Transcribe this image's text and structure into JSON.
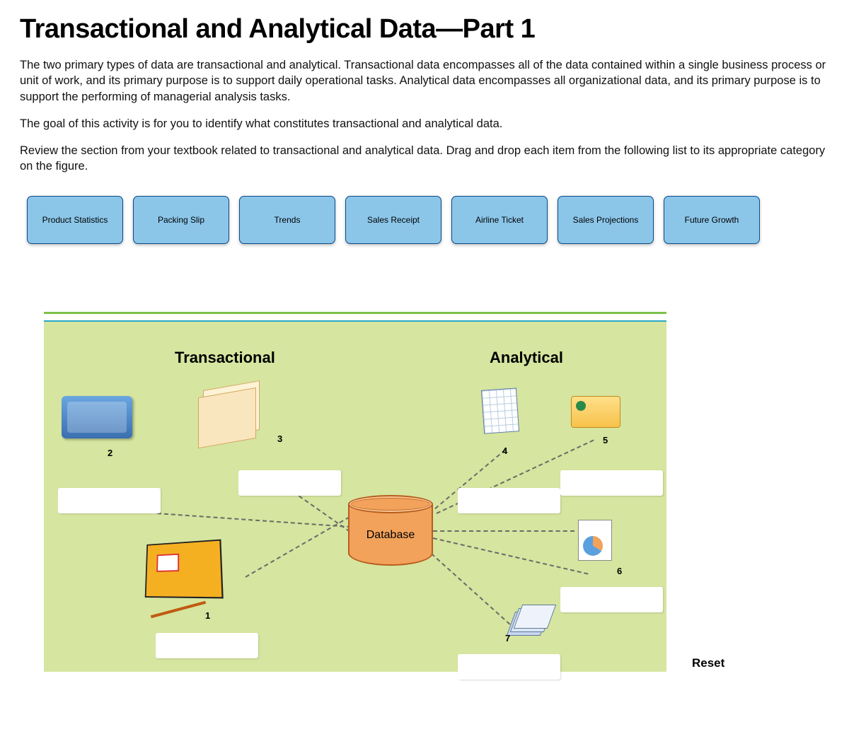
{
  "title": "Transactional and Analytical Data—Part 1",
  "paragraphs": [
    "The two primary types of data are transactional and analytical. Transactional data encompasses all of the data contained within a single business process or unit of work, and its primary purpose is to support daily operational tasks. Analytical data encompasses all organizational data, and its primary purpose is to support the performing of managerial analysis tasks.",
    "The goal of this activity is for you to identify what constitutes transactional and analytical data.",
    "Review the section from your textbook related to transactional and analytical data. Drag and drop each item from the following list to its appropriate category on the figure."
  ],
  "drag_items": [
    "Product Statistics",
    "Packing Slip",
    "Trends",
    "Sales Receipt",
    "Airline Ticket",
    "Sales Projections",
    "Future Growth"
  ],
  "figure": {
    "category_left": "Transactional",
    "category_right": "Analytical",
    "database_label": "Database",
    "drop_numbers": [
      "1",
      "2",
      "3",
      "4",
      "5",
      "6",
      "7"
    ]
  },
  "reset_label": "Reset"
}
